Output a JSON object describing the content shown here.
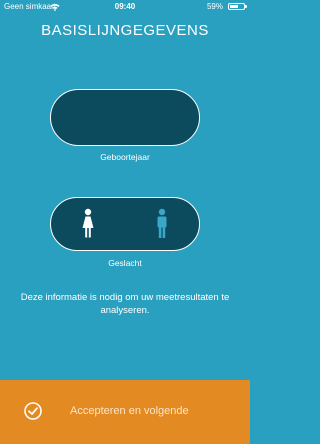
{
  "status_bar": {
    "carrier": "Geen simkaart",
    "time": "09:40",
    "battery_percent": "59%",
    "battery_level": 0.59
  },
  "page": {
    "title": "BASISLIJNGEGEVENS"
  },
  "birth_year": {
    "label": "Geboortejaar",
    "value": ""
  },
  "gender": {
    "label": "Geslacht",
    "options": [
      "female",
      "male"
    ]
  },
  "info": {
    "text": "Deze informatie is nodig om uw meetresultaten te analyseren."
  },
  "footer": {
    "accept_label": "Accepteren en volgende"
  },
  "colors": {
    "background": "#2aa0c0",
    "pill": "#0c4b5d",
    "female_icon": "#ffffff",
    "male_icon": "#3aa7c9",
    "footer": "#e38a22"
  }
}
